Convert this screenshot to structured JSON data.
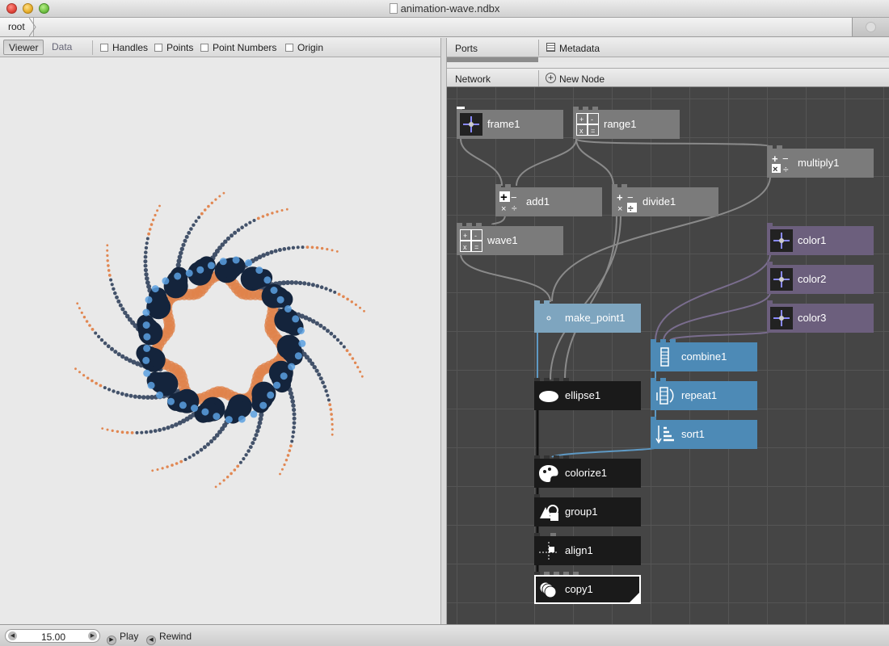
{
  "window": {
    "title": "animation-wave.ndbx"
  },
  "breadcrumb": {
    "root": "root"
  },
  "viewer": {
    "tabs": {
      "viewer": "Viewer",
      "data": "Data"
    },
    "options": {
      "handles": "Handles",
      "points": "Points",
      "point_numbers": "Point Numbers",
      "origin": "Origin"
    }
  },
  "ports_panel": {
    "ports_label": "Ports",
    "metadata_label": "Metadata"
  },
  "network_panel": {
    "network_label": "Network",
    "new_node_label": "New Node",
    "nodes": {
      "frame1": "frame1",
      "range1": "range1",
      "multiply1": "multiply1",
      "add1": "add1",
      "divide1": "divide1",
      "wave1": "wave1",
      "color1": "color1",
      "color2": "color2",
      "color3": "color3",
      "make_point1": "make_point1",
      "combine1": "combine1",
      "ellipse1": "ellipse1",
      "repeat1": "repeat1",
      "sort1": "sort1",
      "colorize1": "colorize1",
      "group1": "group1",
      "align1": "align1",
      "copy1": "copy1"
    }
  },
  "playback": {
    "frame": "15.00",
    "play_label": "Play",
    "rewind_label": "Rewind"
  },
  "colors": {
    "node_gray": "#7b7b7b",
    "node_purple": "#6c5f7d",
    "node_blue": "#4d8ab6",
    "node_black": "#1a1a1a",
    "wire": "#8a8a8a",
    "orange": "#e0824a",
    "navy": "#14243c",
    "light_blue": "#5aa0e0"
  }
}
